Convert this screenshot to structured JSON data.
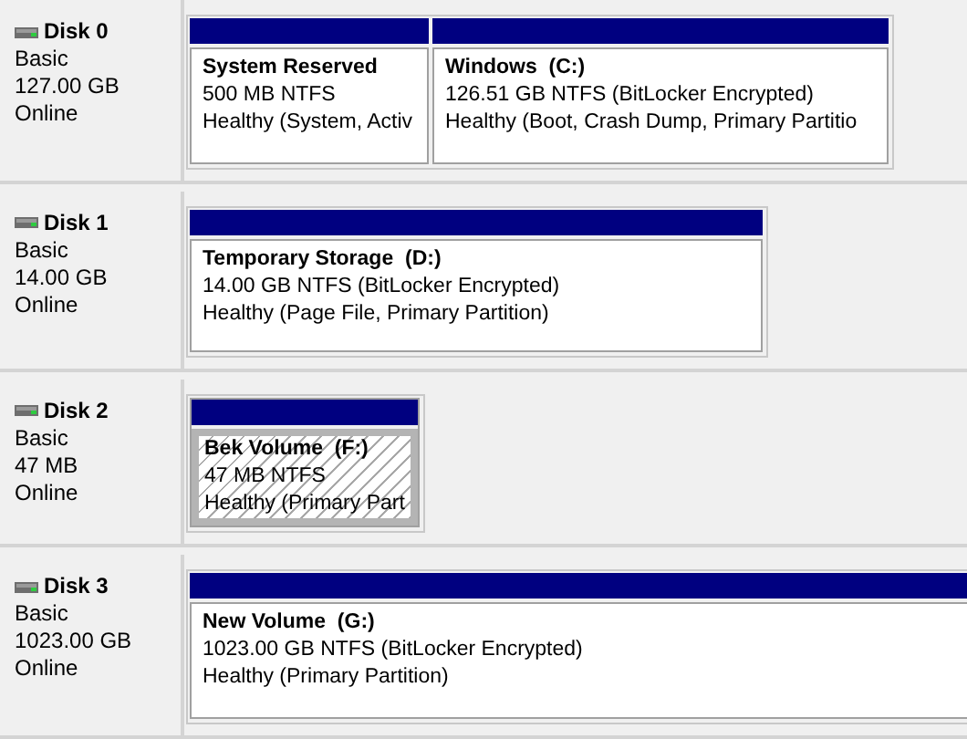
{
  "disks": [
    {
      "name": "Disk 0",
      "type": "Basic",
      "size": "127.00 GB",
      "status": "Online",
      "partitions": [
        {
          "label": "System Reserved",
          "fs": "500 MB NTFS",
          "health": "Healthy (System, Activ",
          "selected": false
        },
        {
          "label": "Windows  (C:)",
          "fs": "126.51 GB NTFS (BitLocker Encrypted)",
          "health": "Healthy (Boot, Crash Dump, Primary Partitio",
          "selected": false
        }
      ]
    },
    {
      "name": "Disk 1",
      "type": "Basic",
      "size": "14.00 GB",
      "status": "Online",
      "partitions": [
        {
          "label": "Temporary Storage  (D:)",
          "fs": "14.00 GB NTFS (BitLocker Encrypted)",
          "health": "Healthy (Page File, Primary Partition)",
          "selected": false
        }
      ]
    },
    {
      "name": "Disk 2",
      "type": "Basic",
      "size": "47 MB",
      "status": "Online",
      "partitions": [
        {
          "label": "Bek Volume  (F:)",
          "fs": "47 MB NTFS",
          "health": "Healthy (Primary Part",
          "selected": true
        }
      ]
    },
    {
      "name": "Disk 3",
      "type": "Basic",
      "size": "1023.00 GB",
      "status": "Online",
      "partitions": [
        {
          "label": "New Volume  (G:)",
          "fs": "1023.00 GB NTFS (BitLocker Encrypted)",
          "health": "Healthy (Primary Partition)",
          "selected": false
        }
      ]
    }
  ]
}
